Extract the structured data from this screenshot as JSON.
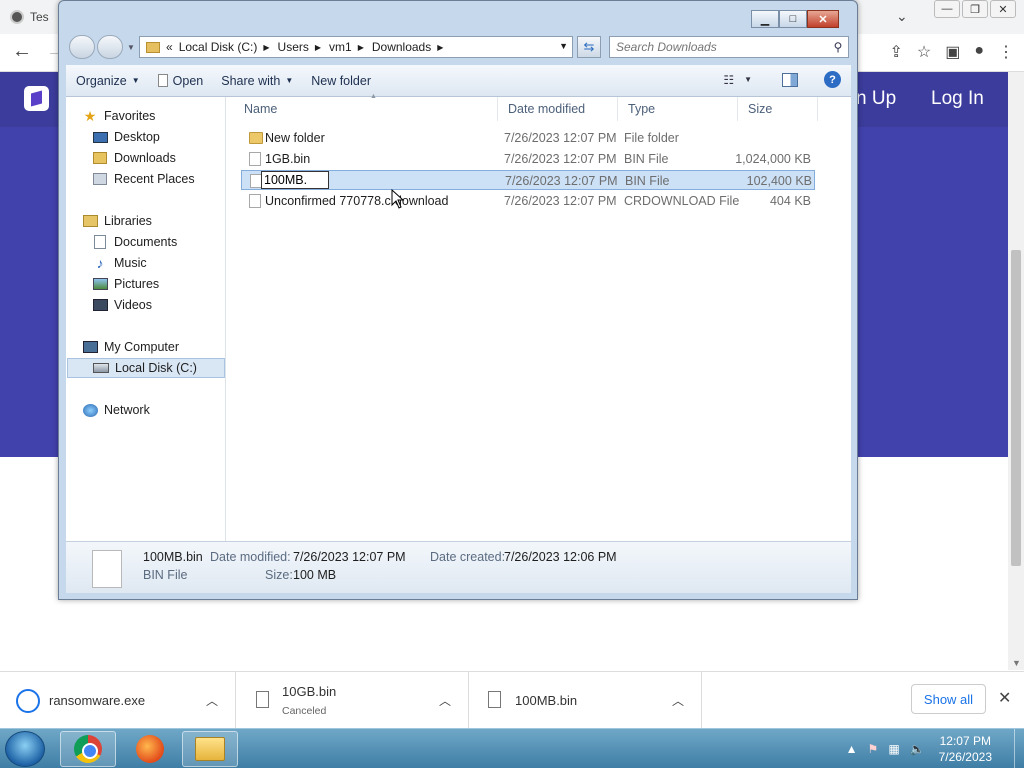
{
  "browser": {
    "tab_title": "Tes",
    "site_links": {
      "signup": "n Up",
      "login": "Log In"
    }
  },
  "explorer": {
    "breadcrumbs": [
      "Local Disk (C:)",
      "Users",
      "vm1",
      "Downloads"
    ],
    "breadcrumb_prefix": "«",
    "search_placeholder": "Search Downloads",
    "toolbar": {
      "organize": "Organize",
      "open": "Open",
      "share_with": "Share with",
      "new_folder": "New folder"
    },
    "nav": {
      "favorites": "Favorites",
      "desktop": "Desktop",
      "downloads": "Downloads",
      "recent_places": "Recent Places",
      "libraries": "Libraries",
      "documents": "Documents",
      "music": "Music",
      "pictures": "Pictures",
      "videos": "Videos",
      "my_computer": "My Computer",
      "local_disk": "Local Disk (C:)",
      "network": "Network"
    },
    "columns": {
      "name": "Name",
      "date": "Date modified",
      "type": "Type",
      "size": "Size"
    },
    "files": [
      {
        "name": "New folder",
        "date": "7/26/2023 12:07 PM",
        "type": "File folder",
        "size": ""
      },
      {
        "name": "1GB.bin",
        "date": "7/26/2023 12:07 PM",
        "type": "BIN File",
        "size": "1,024,000 KB"
      },
      {
        "name": "100MB.",
        "date": "7/26/2023 12:07 PM",
        "type": "BIN File",
        "size": "102,400 KB"
      },
      {
        "name": "Unconfirmed 770778.crdownload",
        "date": "7/26/2023 12:07 PM",
        "type": "CRDOWNLOAD File",
        "size": "404 KB"
      }
    ],
    "details": {
      "filename": "100MB.bin",
      "filetype": "BIN File",
      "date_modified_label": "Date modified:",
      "date_modified": "7/26/2023 12:07 PM",
      "date_created_label": "Date created:",
      "date_created": "7/26/2023 12:06 PM",
      "size_label": "Size:",
      "size": "100 MB"
    }
  },
  "downloads_bar": {
    "items": [
      {
        "name": "ransomware.exe",
        "status": ""
      },
      {
        "name": "10GB.bin",
        "status": "Canceled"
      },
      {
        "name": "100MB.bin",
        "status": ""
      }
    ],
    "show_all": "Show all"
  },
  "taskbar": {
    "time": "12:07 PM",
    "date": "7/26/2023"
  }
}
